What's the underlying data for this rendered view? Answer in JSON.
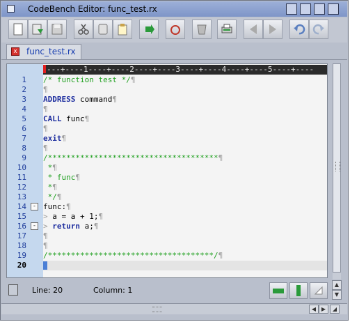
{
  "window": {
    "title": "CodeBench Editor: func_test.rx"
  },
  "toolbar": {
    "buttons": [
      "new-document",
      "open-file",
      "save",
      "cut",
      "copy",
      "paste",
      "jump",
      "mark",
      "clear",
      "print",
      "back",
      "forward",
      "undo",
      "redo"
    ]
  },
  "tab": {
    "label": "func_test.rx",
    "close_glyph": "x"
  },
  "ruler": {
    "text": "---+----1----+----2----+----3----+----4----+----5----+----"
  },
  "editor": {
    "lines": [
      {
        "n": "1",
        "segments": [
          {
            "t": "/* function test */",
            "c": "comment"
          },
          {
            "t": "¶",
            "c": "pil"
          }
        ]
      },
      {
        "n": "2",
        "segments": [
          {
            "t": "¶",
            "c": "pil"
          }
        ]
      },
      {
        "n": "3",
        "segments": [
          {
            "t": "ADDRESS",
            "c": "kw"
          },
          {
            "t": " command",
            "c": ""
          },
          {
            "t": "¶",
            "c": "pil"
          }
        ]
      },
      {
        "n": "4",
        "segments": [
          {
            "t": "¶",
            "c": "pil"
          }
        ]
      },
      {
        "n": "5",
        "segments": [
          {
            "t": "CALL",
            "c": "kw"
          },
          {
            "t": " func",
            "c": ""
          },
          {
            "t": "¶",
            "c": "pil"
          }
        ]
      },
      {
        "n": "6",
        "segments": [
          {
            "t": "¶",
            "c": "pil"
          }
        ]
      },
      {
        "n": "7",
        "segments": [
          {
            "t": "exit",
            "c": "kw"
          },
          {
            "t": "¶",
            "c": "pil"
          }
        ]
      },
      {
        "n": "8",
        "segments": [
          {
            "t": "¶",
            "c": "pil"
          }
        ]
      },
      {
        "n": "9",
        "segments": [
          {
            "t": "/*************************************",
            "c": "comment"
          },
          {
            "t": "¶",
            "c": "pil"
          }
        ]
      },
      {
        "n": "10",
        "segments": [
          {
            "t": " *",
            "c": "comment"
          },
          {
            "t": "¶",
            "c": "pil"
          }
        ]
      },
      {
        "n": "11",
        "segments": [
          {
            "t": " * func",
            "c": "comment"
          },
          {
            "t": "¶",
            "c": "pil"
          }
        ]
      },
      {
        "n": "12",
        "segments": [
          {
            "t": " *",
            "c": "comment"
          },
          {
            "t": "¶",
            "c": "pil"
          }
        ]
      },
      {
        "n": "13",
        "segments": [
          {
            "t": " */",
            "c": "comment"
          },
          {
            "t": "¶",
            "c": "pil"
          }
        ]
      },
      {
        "n": "14",
        "fold": "-",
        "segments": [
          {
            "t": "func:",
            "c": ""
          },
          {
            "t": "¶",
            "c": "pil"
          }
        ]
      },
      {
        "n": "15",
        "segments": [
          {
            "t": "> ",
            "c": "arrow"
          },
          {
            "t": "a = a + 1;",
            "c": ""
          },
          {
            "t": "¶",
            "c": "pil"
          }
        ]
      },
      {
        "n": "16",
        "fold": "-",
        "segments": [
          {
            "t": "> ",
            "c": "arrow"
          },
          {
            "t": "return",
            "c": "kw"
          },
          {
            "t": " a;",
            "c": ""
          },
          {
            "t": "¶",
            "c": "pil"
          }
        ]
      },
      {
        "n": "17",
        "segments": [
          {
            "t": "¶",
            "c": "pil"
          }
        ]
      },
      {
        "n": "18",
        "segments": [
          {
            "t": "¶",
            "c": "pil"
          }
        ]
      },
      {
        "n": "19",
        "segments": [
          {
            "t": "/************************************/",
            "c": "comment"
          },
          {
            "t": "¶",
            "c": "pil"
          }
        ]
      },
      {
        "n": "20",
        "current": true,
        "segments": []
      }
    ]
  },
  "status": {
    "line_label": "Line: 20",
    "column_label": "Column: 1"
  },
  "colors": {
    "comment": "#20a020",
    "keyword": "#2030a0",
    "gutter": "#c5d8ee",
    "ruler_bg": "#2b2b2b"
  }
}
